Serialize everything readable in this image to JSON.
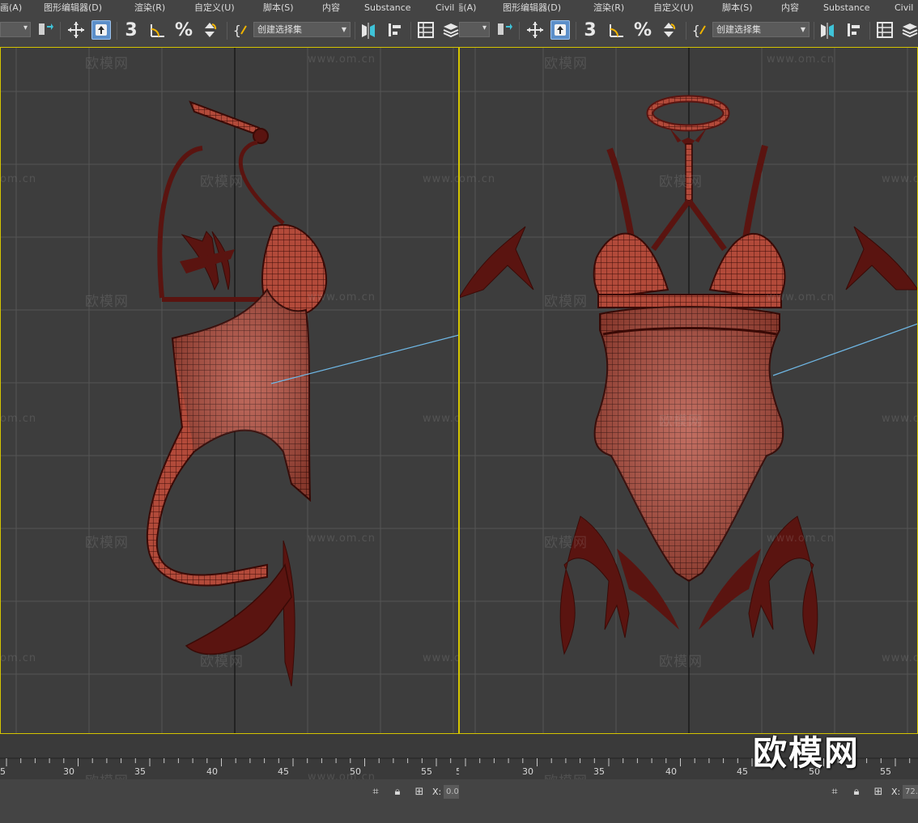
{
  "menu": {
    "left": [
      "画(A)",
      "图形编辑器(D)",
      "渲染(R)",
      "自定义(U)",
      "脚本(S)",
      "内容",
      "Substance",
      "Civil"
    ],
    "right": [
      "Civil画(A)",
      "图形编辑器(D)",
      "渲染(R)",
      "自定义(U)",
      "脚本(S)",
      "内容",
      "Substance",
      "Civil"
    ]
  },
  "toolbar": {
    "selection_set_placeholder": "创建选择集",
    "snap_label": "3",
    "angle_snap_icon": "angle-snap-icon",
    "percent_snap_label": "%",
    "move_icon": "move-icon",
    "select_icon": "select-object-icon",
    "mirror_icon": "mirror-icon",
    "align_icon": "align-icon",
    "layer_icon": "layer-manager-icon",
    "scene_explorer_icon": "scene-explorer-icon"
  },
  "timeline": {
    "left_labels": [
      "5",
      "30",
      "35",
      "40",
      "45",
      "50",
      "55",
      "5"
    ],
    "right_labels": [
      "30",
      "35",
      "40",
      "45",
      "50",
      "55"
    ]
  },
  "status": {
    "x_label": "X:",
    "x_value_left": "0.0",
    "x_value_right": "72."
  },
  "watermarks": {
    "brand": "欧模网",
    "url": "www.om.cn",
    "url_clipped": "om.cn",
    "overlay": "欧模网"
  },
  "colors": {
    "mesh_fill": "#b24a3a",
    "mesh_wire": "#3a0a06",
    "viewport_bg": "#3d3d3d",
    "active_border": "#d4c400",
    "accent_button": "#5c8fc9",
    "light_line": "#6fb8e6"
  }
}
